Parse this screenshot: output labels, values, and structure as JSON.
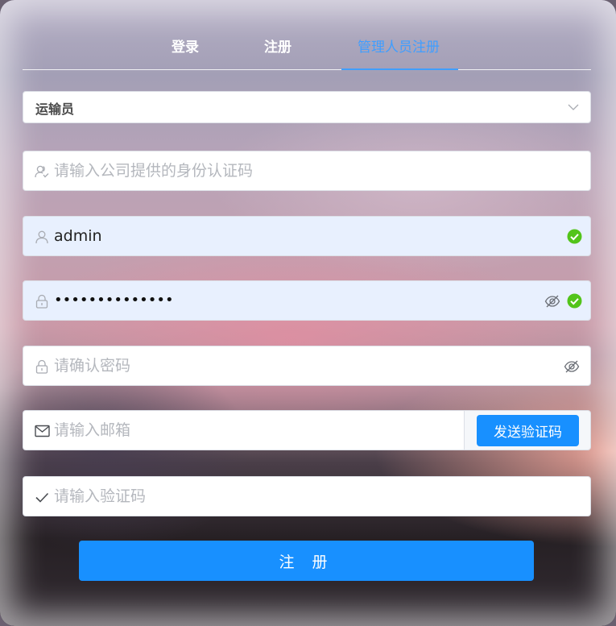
{
  "tabs": [
    {
      "label": "登录"
    },
    {
      "label": "注册"
    },
    {
      "label": "管理人员注册"
    }
  ],
  "role_select": {
    "value": "运输员",
    "icon": "chevron-down-icon"
  },
  "auth_code": {
    "placeholder": "请输入公司提供的身份认证码",
    "icon": "user-group-icon"
  },
  "username": {
    "value": "admin",
    "icon": "user-icon",
    "valid": true
  },
  "password": {
    "value": "••••••••••••••",
    "icon": "lock-icon",
    "valid": true
  },
  "confirm_password": {
    "placeholder": "请确认密码",
    "icon": "lock-icon"
  },
  "email": {
    "placeholder": "请输入邮箱",
    "icon": "mail-icon",
    "send_label": "发送验证码"
  },
  "verify_code": {
    "placeholder": "请输入验证码",
    "icon": "check-icon"
  },
  "submit_label": "注 册",
  "colors": {
    "accent": "#409eff",
    "button": "#1890ff",
    "success": "#52c41a"
  }
}
